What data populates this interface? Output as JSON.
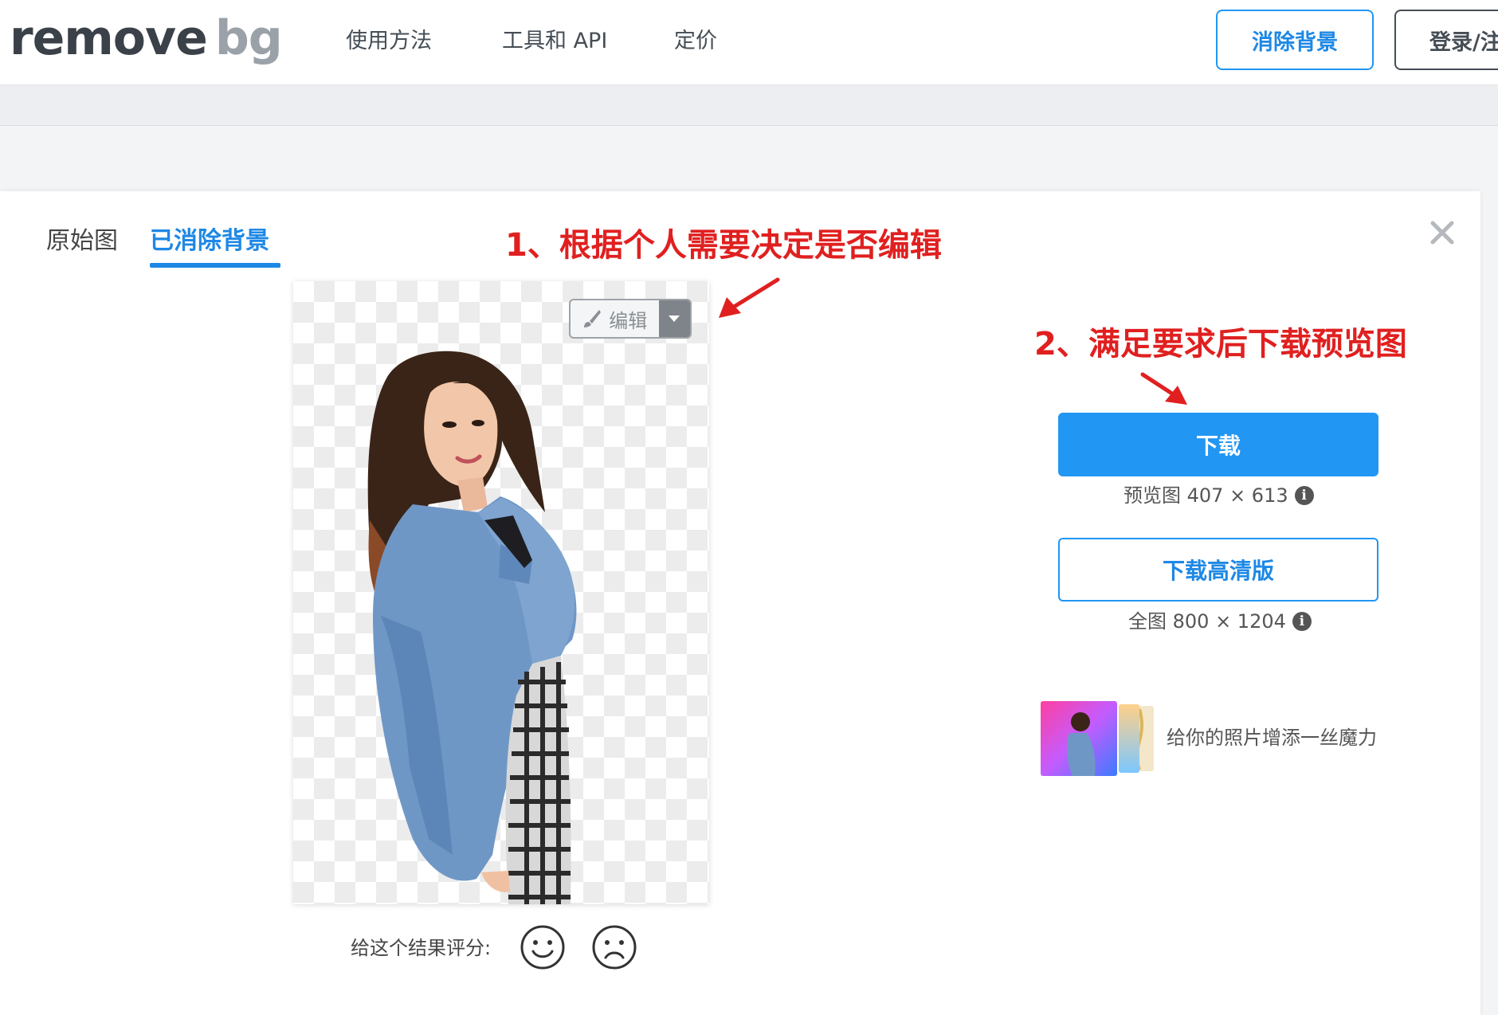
{
  "header": {
    "logo_main": "remove",
    "logo_accent": "bg",
    "nav": [
      "使用方法",
      "工具和 API",
      "定价"
    ],
    "remove_bg_button": "消除背景",
    "login_button": "登录/注"
  },
  "tabs": {
    "original": "原始图",
    "removed": "已消除背景"
  },
  "editor": {
    "edit_label": "编辑"
  },
  "rating": {
    "label": "给这个结果评分:"
  },
  "annotations": {
    "step1": "1、根据个人需要决定是否编辑",
    "step2": "2、满足要求后下载预览图"
  },
  "download": {
    "button": "下载",
    "preview_caption": "预览图 407 × 613",
    "hd_button": "下载高清版",
    "full_caption": "全图 800 × 1204"
  },
  "promo": {
    "text": "给你的照片增添一丝魔力"
  },
  "colors": {
    "brand_blue": "#2196f3",
    "annotation_red": "#e02020"
  },
  "icons": [
    "brush-icon",
    "chevron-down-icon",
    "close-icon",
    "info-icon",
    "smiley-face-icon",
    "sad-face-icon"
  ]
}
